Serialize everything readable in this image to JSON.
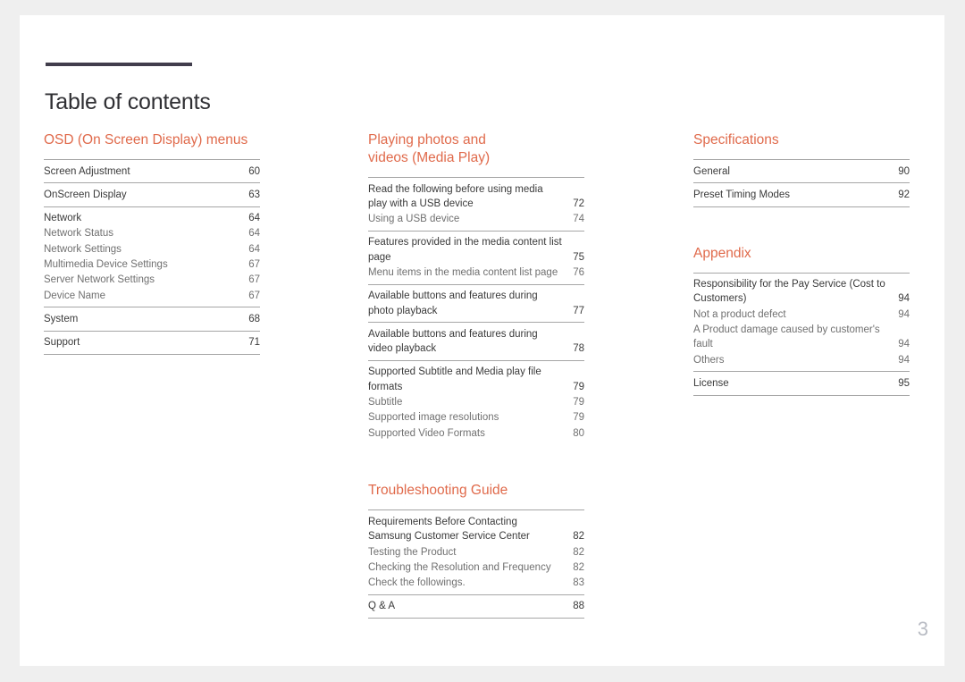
{
  "document": {
    "title": "Table of contents",
    "folio": "3",
    "accent_color": "#e06a4b",
    "rule_color": "#413d4c",
    "main_text_color": "#3a3a3a",
    "sub_text_color": "#707070",
    "folio_color": "#b9bcc4",
    "page_background": "#ffffff",
    "canvas_background": "#efefef"
  },
  "columns": [
    {
      "name": "column-one",
      "sections": [
        {
          "heading": "OSD (On Screen Display) menus",
          "groups": [
            {
              "entries": [
                {
                  "label": "Screen Adjustment",
                  "page": "60",
                  "level": "main"
                }
              ]
            },
            {
              "entries": [
                {
                  "label": "OnScreen Display",
                  "page": "63",
                  "level": "main"
                }
              ]
            },
            {
              "entries": [
                {
                  "label": "Network",
                  "page": "64",
                  "level": "main"
                },
                {
                  "label": "Network Status",
                  "page": "64",
                  "level": "sub"
                },
                {
                  "label": "Network Settings",
                  "page": "64",
                  "level": "sub"
                },
                {
                  "label": "Multimedia Device Settings",
                  "page": "67",
                  "level": "sub"
                },
                {
                  "label": "Server Network Settings",
                  "page": "67",
                  "level": "sub"
                },
                {
                  "label": "Device Name",
                  "page": "67",
                  "level": "sub"
                }
              ]
            },
            {
              "entries": [
                {
                  "label": "System",
                  "page": "68",
                  "level": "main"
                }
              ]
            },
            {
              "entries": [
                {
                  "label": "Support",
                  "page": "71",
                  "level": "main"
                }
              ],
              "closing_rule": true
            }
          ]
        }
      ]
    },
    {
      "name": "column-two",
      "sections": [
        {
          "heading": "Playing photos and\nvideos (Media Play)",
          "groups": [
            {
              "entries": [
                {
                  "label": "Read the following before using media play with a USB device",
                  "page": "72",
                  "level": "main"
                },
                {
                  "label": "Using a USB device",
                  "page": "74",
                  "level": "sub"
                }
              ]
            },
            {
              "entries": [
                {
                  "label": "Features provided in the media content list page",
                  "page": "75",
                  "level": "main"
                },
                {
                  "label": "Menu items in the media content list page",
                  "page": "76",
                  "level": "sub"
                }
              ]
            },
            {
              "entries": [
                {
                  "label": "Available buttons and features during photo playback",
                  "page": "77",
                  "level": "main"
                }
              ]
            },
            {
              "entries": [
                {
                  "label": "Available buttons and features during video playback",
                  "page": "78",
                  "level": "main"
                }
              ]
            },
            {
              "entries": [
                {
                  "label": "Supported Subtitle and Media play file formats",
                  "page": "79",
                  "level": "main"
                },
                {
                  "label": "Subtitle",
                  "page": "79",
                  "level": "sub"
                },
                {
                  "label": "Supported image resolutions",
                  "page": "79",
                  "level": "sub"
                },
                {
                  "label": "Supported Video Formats",
                  "page": "80",
                  "level": "sub"
                }
              ]
            }
          ]
        },
        {
          "heading": "Troubleshooting Guide",
          "spaced": true,
          "groups": [
            {
              "entries": [
                {
                  "label": "Requirements Before Contacting Samsung Customer Service Center",
                  "page": "82",
                  "level": "main"
                },
                {
                  "label": "Testing the Product",
                  "page": "82",
                  "level": "sub"
                },
                {
                  "label": "Checking the Resolution and Frequency",
                  "page": "82",
                  "level": "sub"
                },
                {
                  "label": "Check the followings.",
                  "page": "83",
                  "level": "sub"
                }
              ]
            },
            {
              "entries": [
                {
                  "label": "Q & A",
                  "page": "88",
                  "level": "main"
                }
              ],
              "closing_rule": true
            }
          ]
        }
      ]
    },
    {
      "name": "column-three",
      "sections": [
        {
          "heading": "Specifications",
          "groups": [
            {
              "entries": [
                {
                  "label": "General",
                  "page": "90",
                  "level": "main"
                }
              ]
            },
            {
              "entries": [
                {
                  "label": "Preset Timing Modes",
                  "page": "92",
                  "level": "main"
                }
              ],
              "closing_rule": true
            }
          ]
        },
        {
          "heading": "Appendix",
          "spaced": true,
          "groups": [
            {
              "entries": [
                {
                  "label": "Responsibility for the Pay Service (Cost to Customers)",
                  "page": "94",
                  "level": "main"
                },
                {
                  "label": "Not a product defect",
                  "page": "94",
                  "level": "sub"
                },
                {
                  "label": "A Product damage caused by customer's fault",
                  "page": "94",
                  "level": "sub"
                },
                {
                  "label": "Others",
                  "page": "94",
                  "level": "sub"
                }
              ]
            },
            {
              "entries": [
                {
                  "label": "License",
                  "page": "95",
                  "level": "main"
                }
              ],
              "closing_rule": true
            }
          ]
        }
      ]
    }
  ]
}
